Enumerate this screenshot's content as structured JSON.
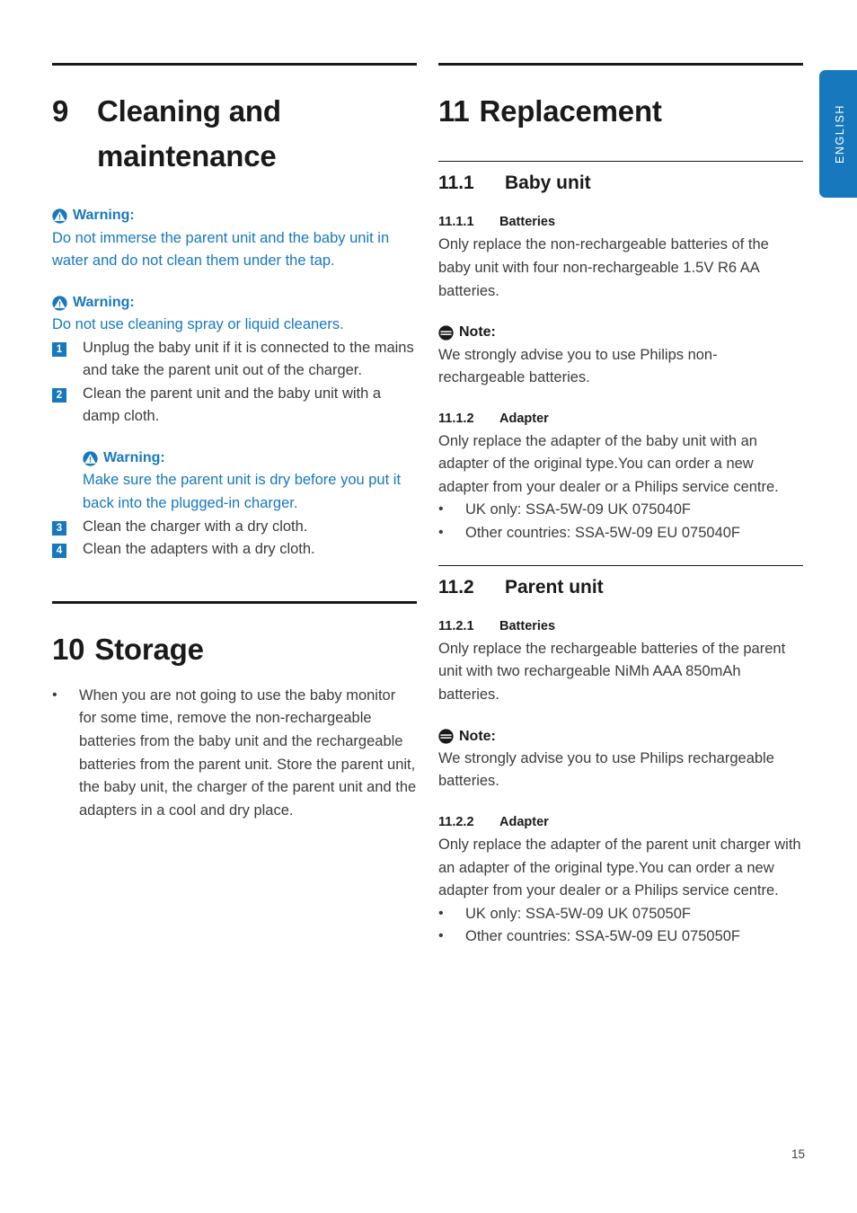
{
  "page": {
    "number": "15",
    "language_tab": "ENGLISH",
    "accent_blue": "#1878be",
    "body_color": "#3c3c3c",
    "heading_color": "#1a1a1a"
  },
  "left_column": {
    "chapter": {
      "number": "9",
      "title_line1": "Cleaning and",
      "title_line2": "maintenance"
    },
    "warning1": {
      "icon": "warning-icon",
      "label": "Warning:",
      "text": "Do not immerse the parent unit and the baby unit in water and do not clean them under the tap."
    },
    "warning2": {
      "icon": "warning-icon",
      "label": "Warning:",
      "text": "Do not use cleaning spray or liquid cleaners."
    },
    "steps_a": [
      {
        "num": "1",
        "text": "Unplug the baby unit if it is connected to the mains and take the parent unit out of the charger."
      },
      {
        "num": "2",
        "text": "Clean the parent unit and the baby unit with a damp cloth."
      }
    ],
    "warning3": {
      "icon": "warning-icon",
      "label": "Warning:",
      "text": "Make sure the parent unit is dry before you put it back into the plugged-in charger."
    },
    "steps_b": [
      {
        "num": "3",
        "text": "Clean the charger with a dry cloth."
      },
      {
        "num": "4",
        "text": "Clean the adapters with a dry cloth."
      }
    ],
    "storage": {
      "number": "10",
      "title": "Storage",
      "bullets": [
        {
          "marker": "•",
          "text": "When you are not going to use the baby monitor for some time, remove the non-rechargeable batteries from the baby unit and the rechargeable batteries from the parent unit. Store the parent unit, the baby unit, the charger of the parent unit and the adapters in a cool and dry place."
        }
      ]
    }
  },
  "right_column": {
    "chapter": {
      "number": "11",
      "title": "Replacement"
    },
    "s11_1": {
      "number": "11.1",
      "title": "Baby unit",
      "batteries": {
        "number": "11.1.1",
        "title": "Batteries",
        "text": "Only replace the non-rechargeable batteries of the baby unit with four non-rechargeable 1.5V R6 AA batteries."
      },
      "note": {
        "icon": "note-icon",
        "label": "Note:",
        "text": "We strongly advise you to use Philips non-rechargeable batteries."
      },
      "adapter": {
        "number": "11.1.2",
        "title": "Adapter",
        "text": "Only replace the adapter of the baby unit with an adapter of the original type.You can order a new adapter from your dealer or a Philips service centre.",
        "bullets": [
          {
            "marker": "•",
            "text": "UK only: SSA-5W-09 UK 075040F"
          },
          {
            "marker": "•",
            "text": "Other countries: SSA-5W-09 EU 075040F"
          }
        ]
      }
    },
    "s11_2": {
      "number": "11.2",
      "title": "Parent unit",
      "batteries": {
        "number": "11.2.1",
        "title": "Batteries",
        "text": "Only replace the rechargeable batteries of the parent unit with two rechargeable NiMh AAA 850mAh batteries."
      },
      "note": {
        "icon": "note-icon",
        "label": "Note:",
        "text": "We strongly advise you to use Philips rechargeable batteries."
      },
      "adapter": {
        "number": "11.2.2",
        "title": "Adapter",
        "text": "Only replace the adapter of the parent unit charger with an adapter of the original type.You can order a new adapter from your dealer or a Philips service centre.",
        "bullets": [
          {
            "marker": "•",
            "text": "UK only: SSA-5W-09 UK 075050F"
          },
          {
            "marker": "•",
            "text": "Other countries: SSA-5W-09 EU 075050F"
          }
        ]
      }
    }
  }
}
